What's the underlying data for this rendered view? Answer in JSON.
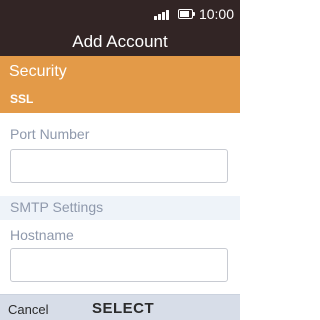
{
  "status_bar": {
    "time": "10:00",
    "signal_icon": "signal-icon",
    "battery_icon": "battery-icon"
  },
  "header": {
    "title": "Add Account"
  },
  "items": [
    {
      "title": "Security",
      "value": "SSL"
    },
    {
      "label": "Port Number",
      "value": ""
    },
    {
      "section": "SMTP Settings"
    },
    {
      "label": "Hostname",
      "value": ""
    }
  ],
  "softkeys": {
    "left": "Cancel",
    "center": "SELECT"
  },
  "colors": {
    "status_bg": "#322525",
    "title_bg": "#322525",
    "highlight_bg": "#e39a48",
    "section_bg": "#eef3f9",
    "softkey_bg": "#d7dde8"
  }
}
